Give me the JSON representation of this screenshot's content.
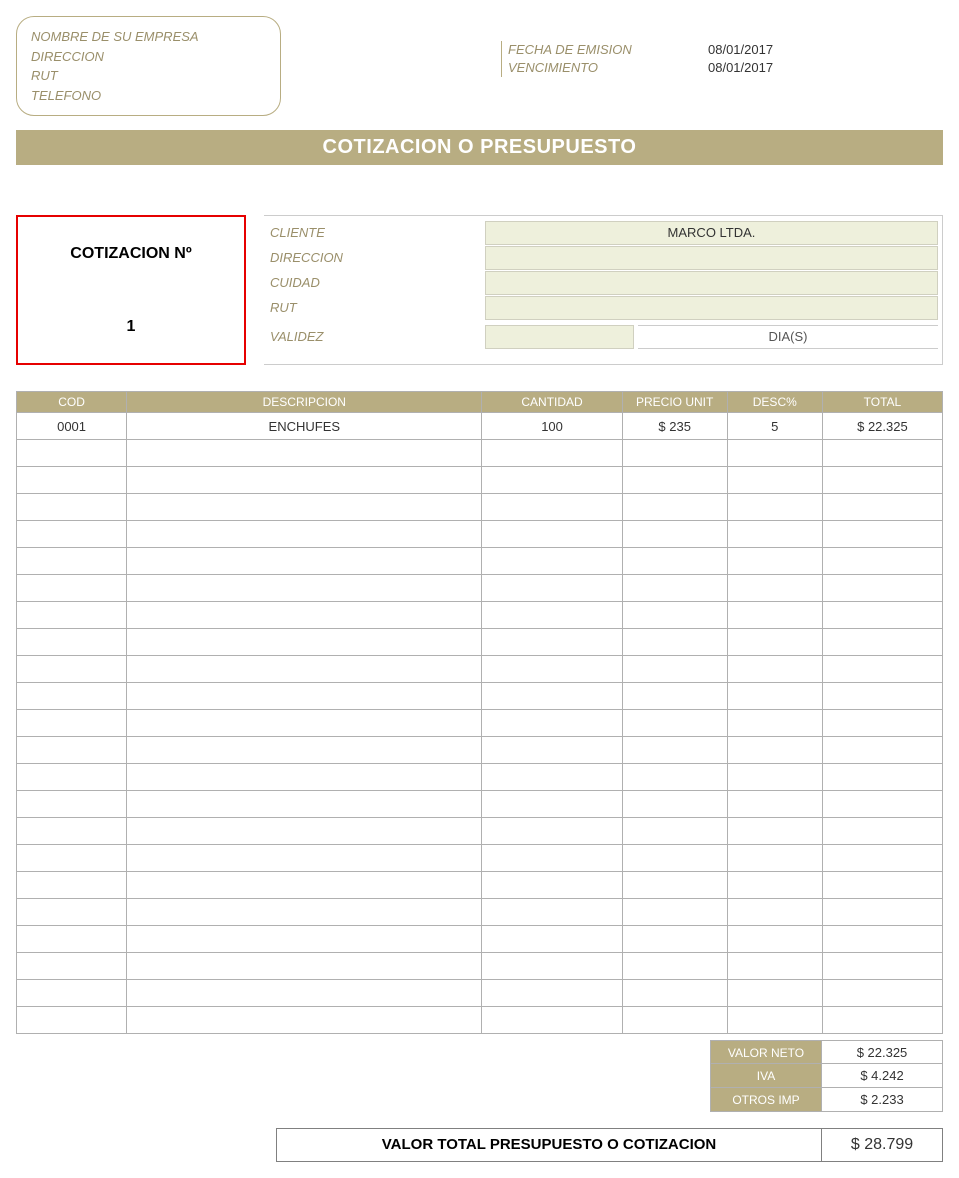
{
  "company": {
    "name": "NOMBRE DE SU EMPRESA",
    "address": "DIRECCION",
    "rut": "RUT",
    "phone": "TELEFONO"
  },
  "emission": {
    "label_date": "FECHA DE EMISION",
    "label_due": "VENCIMIENTO",
    "date": "08/01/2017",
    "due": "08/01/2017"
  },
  "title": "COTIZACION O PRESUPUESTO",
  "quote_box": {
    "label": "COTIZACION Nº",
    "number": "1"
  },
  "client": {
    "labels": {
      "cliente": "CLIENTE",
      "direccion": "DIRECCION",
      "cuidad": "CUIDAD",
      "rut": "RUT",
      "validez": "VALIDEZ"
    },
    "cliente": "MARCO LTDA.",
    "direccion": "",
    "cuidad": "",
    "rut": "",
    "validez": "",
    "validez_unit": "DIA(S)"
  },
  "table": {
    "headers": {
      "cod": "COD",
      "desc": "DESCRIPCION",
      "cant": "CANTIDAD",
      "precio": "PRECIO UNIT",
      "descp": "DESC%",
      "total": "TOTAL"
    },
    "rows": [
      {
        "cod": "0001",
        "desc": "ENCHUFES",
        "cant": "100",
        "precio": "$ 235",
        "descp": "5",
        "total": "$ 22.325"
      },
      {
        "cod": "",
        "desc": "",
        "cant": "",
        "precio": "",
        "descp": "",
        "total": ""
      },
      {
        "cod": "",
        "desc": "",
        "cant": "",
        "precio": "",
        "descp": "",
        "total": ""
      },
      {
        "cod": "",
        "desc": "",
        "cant": "",
        "precio": "",
        "descp": "",
        "total": ""
      },
      {
        "cod": "",
        "desc": "",
        "cant": "",
        "precio": "",
        "descp": "",
        "total": ""
      },
      {
        "cod": "",
        "desc": "",
        "cant": "",
        "precio": "",
        "descp": "",
        "total": ""
      },
      {
        "cod": "",
        "desc": "",
        "cant": "",
        "precio": "",
        "descp": "",
        "total": ""
      },
      {
        "cod": "",
        "desc": "",
        "cant": "",
        "precio": "",
        "descp": "",
        "total": ""
      },
      {
        "cod": "",
        "desc": "",
        "cant": "",
        "precio": "",
        "descp": "",
        "total": ""
      },
      {
        "cod": "",
        "desc": "",
        "cant": "",
        "precio": "",
        "descp": "",
        "total": ""
      },
      {
        "cod": "",
        "desc": "",
        "cant": "",
        "precio": "",
        "descp": "",
        "total": ""
      },
      {
        "cod": "",
        "desc": "",
        "cant": "",
        "precio": "",
        "descp": "",
        "total": ""
      },
      {
        "cod": "",
        "desc": "",
        "cant": "",
        "precio": "",
        "descp": "",
        "total": ""
      },
      {
        "cod": "",
        "desc": "",
        "cant": "",
        "precio": "",
        "descp": "",
        "total": ""
      },
      {
        "cod": "",
        "desc": "",
        "cant": "",
        "precio": "",
        "descp": "",
        "total": ""
      },
      {
        "cod": "",
        "desc": "",
        "cant": "",
        "precio": "",
        "descp": "",
        "total": ""
      },
      {
        "cod": "",
        "desc": "",
        "cant": "",
        "precio": "",
        "descp": "",
        "total": ""
      },
      {
        "cod": "",
        "desc": "",
        "cant": "",
        "precio": "",
        "descp": "",
        "total": ""
      },
      {
        "cod": "",
        "desc": "",
        "cant": "",
        "precio": "",
        "descp": "",
        "total": ""
      },
      {
        "cod": "",
        "desc": "",
        "cant": "",
        "precio": "",
        "descp": "",
        "total": ""
      },
      {
        "cod": "",
        "desc": "",
        "cant": "",
        "precio": "",
        "descp": "",
        "total": ""
      },
      {
        "cod": "",
        "desc": "",
        "cant": "",
        "precio": "",
        "descp": "",
        "total": ""
      },
      {
        "cod": "",
        "desc": "",
        "cant": "",
        "precio": "",
        "descp": "",
        "total": ""
      }
    ]
  },
  "totals": {
    "net": {
      "label": "VALOR NETO",
      "value": "$ 22.325"
    },
    "iva": {
      "label": "IVA",
      "value": "$ 4.242"
    },
    "other": {
      "label": "OTROS IMP",
      "value": "$ 2.233"
    }
  },
  "grand_total": {
    "label": "VALOR TOTAL PRESUPUESTO O COTIZACION",
    "value": "$ 28.799"
  }
}
